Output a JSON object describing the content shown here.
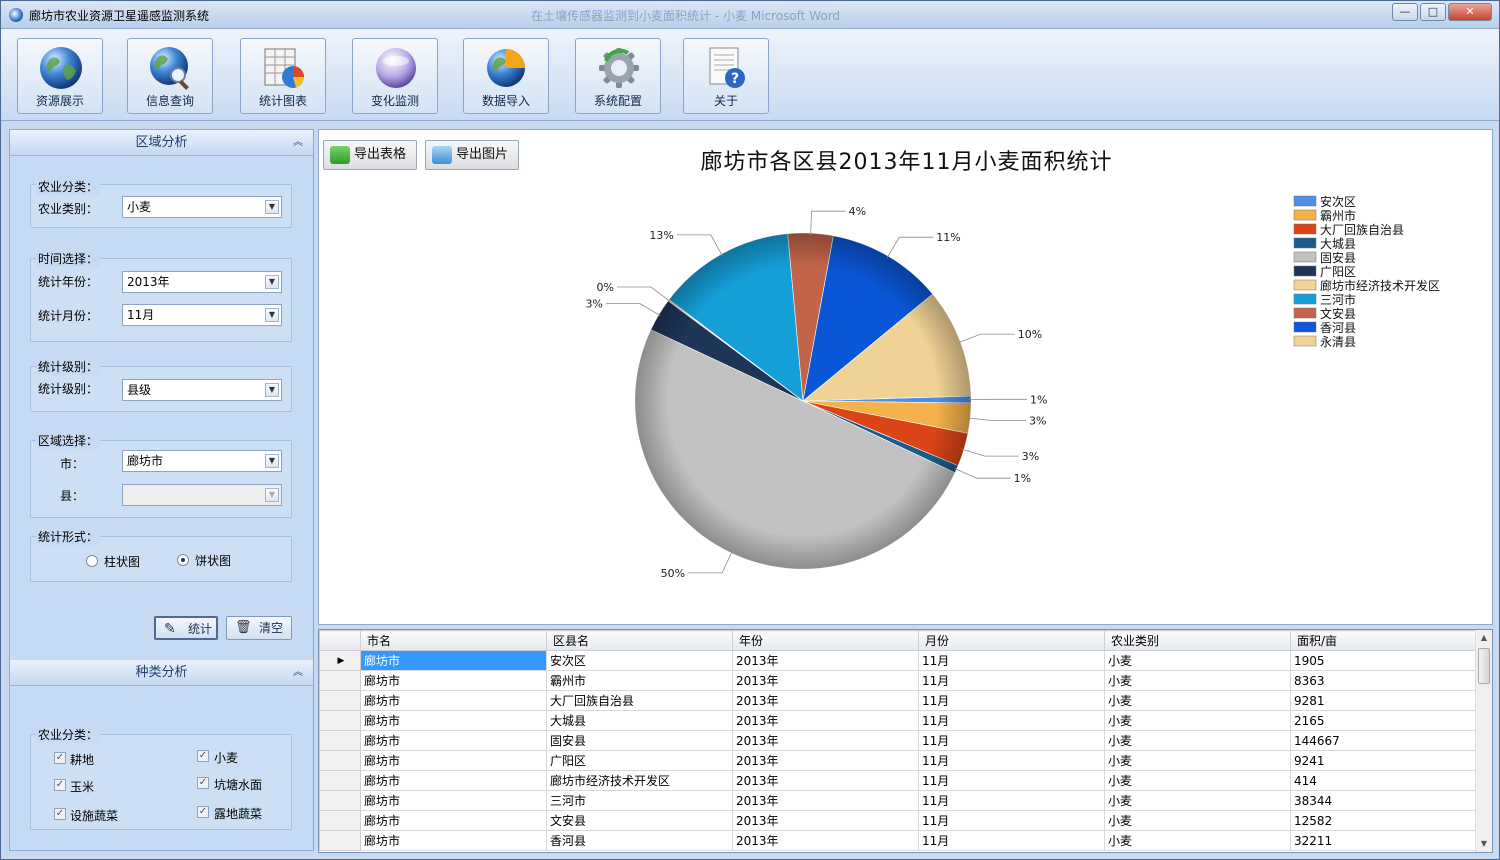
{
  "window": {
    "title": "廊坊市农业资源卫星遥感监测系统",
    "ghost_title": "在土壤传感器监测到小麦面积统计 - 小麦 Microsoft Word",
    "min_label": "—",
    "max_label": "□",
    "close_label": "✕"
  },
  "toolbar": {
    "buttons": [
      {
        "label": "资源展示",
        "icon": "globe-icon"
      },
      {
        "label": "信息查询",
        "icon": "globe-search-icon"
      },
      {
        "label": "统计图表",
        "icon": "chart-table-icon"
      },
      {
        "label": "变化监测",
        "icon": "orb-icon"
      },
      {
        "label": "数据导入",
        "icon": "globe-import-icon"
      },
      {
        "label": "系统配置",
        "icon": "gear-icon"
      },
      {
        "label": "关于",
        "icon": "help-document-icon"
      }
    ]
  },
  "left": {
    "region_header": "区域分析",
    "species_header": "种类分析",
    "agri_group_title": "农业分类：",
    "agri_type_label": "农业类别：",
    "agri_type_value": "小麦",
    "time_group_title": "时间选择：",
    "year_label": "统计年份：",
    "year_value": "2013年",
    "month_label": "统计月份：",
    "month_value": "11月",
    "level_group_title": "统计级别：",
    "level_label": "统计级别：",
    "level_value": "县级",
    "area_group_title": "区域选择：",
    "city_label": "市：",
    "city_value": "廊坊市",
    "county_label": "县：",
    "county_value": "",
    "form_group_title": "统计形式：",
    "bar_option": "柱状图",
    "pie_option": "饼状图",
    "stat_button": "统计",
    "clear_button": "清空",
    "species_group_title": "农业分类：",
    "checkboxes": [
      {
        "label": "耕地",
        "checked": true
      },
      {
        "label": "小麦",
        "checked": true
      },
      {
        "label": "玉米",
        "checked": true
      },
      {
        "label": "坑塘水面",
        "checked": true
      },
      {
        "label": "设施蔬菜",
        "checked": true
      },
      {
        "label": "露地蔬菜",
        "checked": true
      }
    ]
  },
  "right": {
    "export_table": "导出表格",
    "export_image": "导出图片"
  },
  "chart_data": {
    "type": "pie",
    "title": "廊坊市各区县2013年11月小麦面积统计",
    "legend_position": "top-right",
    "categories": [
      "安次区",
      "霸州市",
      "大厂回族自治县",
      "大城县",
      "固安县",
      "广阳区",
      "廊坊市经济技术开发区",
      "三河市",
      "文安县",
      "香河县",
      "永清县"
    ],
    "values": [
      1905,
      8363,
      9281,
      2165,
      144667,
      9241,
      414,
      38344,
      12582,
      32211,
      30450
    ],
    "percent_labels": [
      "1%",
      "3%",
      "3%",
      "1%",
      "50%",
      "3%",
      "0%",
      "13%",
      "4%",
      "11%",
      "10%"
    ],
    "colors": [
      "#4d8fe0",
      "#f5b14a",
      "#db4416",
      "#1c5c8c",
      "#c2c2c2",
      "#1e3558",
      "#f2d494",
      "#159fd9",
      "#c2644a",
      "#0a56d6",
      "#f0d296"
    ]
  },
  "table": {
    "columns": [
      "市名",
      "区县名",
      "年份",
      "月份",
      "农业类别",
      "面积/亩"
    ],
    "rows": [
      [
        "廊坊市",
        "安次区",
        "2013年",
        "11月",
        "小麦",
        "1905"
      ],
      [
        "廊坊市",
        "霸州市",
        "2013年",
        "11月",
        "小麦",
        "8363"
      ],
      [
        "廊坊市",
        "大厂回族自治县",
        "2013年",
        "11月",
        "小麦",
        "9281"
      ],
      [
        "廊坊市",
        "大城县",
        "2013年",
        "11月",
        "小麦",
        "2165"
      ],
      [
        "廊坊市",
        "固安县",
        "2013年",
        "11月",
        "小麦",
        "144667"
      ],
      [
        "廊坊市",
        "广阳区",
        "2013年",
        "11月",
        "小麦",
        "9241"
      ],
      [
        "廊坊市",
        "廊坊市经济技术开发区",
        "2013年",
        "11月",
        "小麦",
        "414"
      ],
      [
        "廊坊市",
        "三河市",
        "2013年",
        "11月",
        "小麦",
        "38344"
      ],
      [
        "廊坊市",
        "文安县",
        "2013年",
        "11月",
        "小麦",
        "12582"
      ],
      [
        "廊坊市",
        "香河县",
        "2013年",
        "11月",
        "小麦",
        "32211"
      ]
    ]
  }
}
